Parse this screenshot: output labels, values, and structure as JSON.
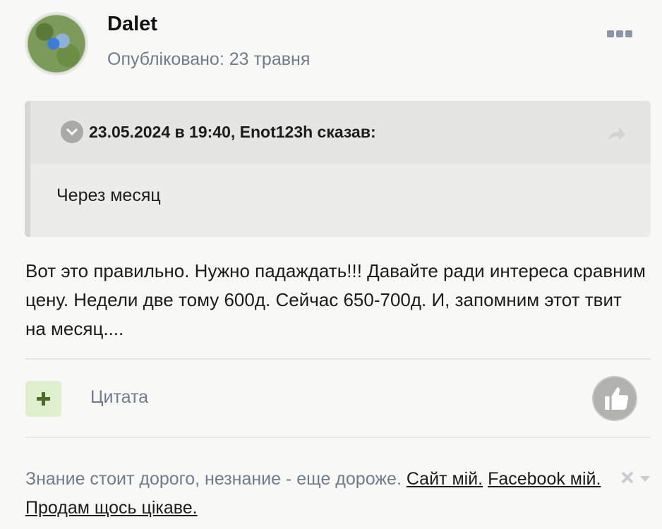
{
  "post": {
    "author": "Dalet",
    "published": "Опубліковано: 23 травня",
    "quote": {
      "header": "23.05.2024 в 19:40, Enot123h сказав:",
      "text": "Через месяц"
    },
    "body": "Вот это правильно. Нужно падаждать!!! Давайте ради интереса сравним цену. Недели две тому 600д. Сейчас 650-700д. И, запомним этот твит на месяц....",
    "actions": {
      "quote_label": "Цитата"
    },
    "signature": {
      "text": "Знание стоит дорого, незнание - еще дороже.",
      "links": [
        "Сайт мій.",
        "Facebook мій.",
        "Продам щось цікаве."
      ]
    }
  },
  "icons": {
    "more": "more-icon",
    "chevron": "chevron-down-icon",
    "share": "share-icon",
    "plus": "plus-icon",
    "like": "thumbs-up-icon",
    "close": "close-icon",
    "dropdown": "caret-down-icon"
  },
  "colors": {
    "background": "#f8f8f6",
    "meta_text": "#6f7c8e",
    "plus_bg": "#dff0cf",
    "plus_fg": "#4b6c25",
    "like_bg": "#b1b1ae"
  }
}
